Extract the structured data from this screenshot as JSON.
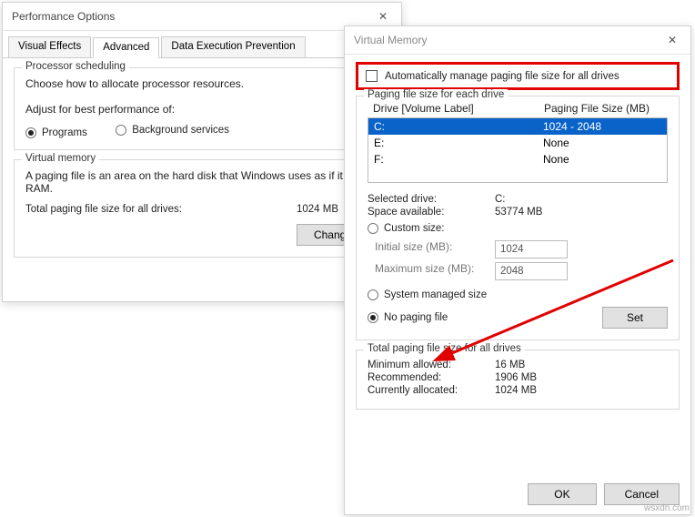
{
  "perf": {
    "title": "Performance Options",
    "tabs": [
      "Visual Effects",
      "Advanced",
      "Data Execution Prevention"
    ],
    "activeTab": 1,
    "sched": {
      "legend": "Processor scheduling",
      "choose": "Choose how to allocate processor resources.",
      "adjust": "Adjust for best performance of:",
      "programs": "Programs",
      "background": "Background services"
    },
    "vm": {
      "legend": "Virtual memory",
      "desc": "A paging file is an area on the hard disk that Windows uses as if it were RAM.",
      "totalLabel": "Total paging file size for all drives:",
      "totalValue": "1024 MB",
      "change": "Change..."
    }
  },
  "vmem": {
    "title": "Virtual Memory",
    "auto": "Automatically manage paging file size for all drives",
    "pagingLegend": "Paging file size for each drive",
    "hdrDrive": "Drive  [Volume Label]",
    "hdrSize": "Paging File Size (MB)",
    "drives": [
      {
        "d": "C:",
        "s": "1024 - 2048",
        "sel": true
      },
      {
        "d": "E:",
        "s": "None",
        "sel": false
      },
      {
        "d": "F:",
        "s": "None",
        "sel": false
      }
    ],
    "selDriveLabel": "Selected drive:",
    "selDriveVal": "C:",
    "spaceLabel": "Space available:",
    "spaceVal": "53774 MB",
    "custom": "Custom size:",
    "initLabel": "Initial size (MB):",
    "initVal": "1024",
    "maxLabel": "Maximum size (MB):",
    "maxVal": "2048",
    "sysManaged": "System managed size",
    "noPaging": "No paging file",
    "set": "Set",
    "totalLegend": "Total paging file size for all drives",
    "minLabel": "Minimum allowed:",
    "minVal": "16 MB",
    "recLabel": "Recommended:",
    "recVal": "1906 MB",
    "curLabel": "Currently allocated:",
    "curVal": "1024 MB",
    "ok": "OK",
    "cancel": "Cancel"
  },
  "watermark": "wsxdn.com"
}
